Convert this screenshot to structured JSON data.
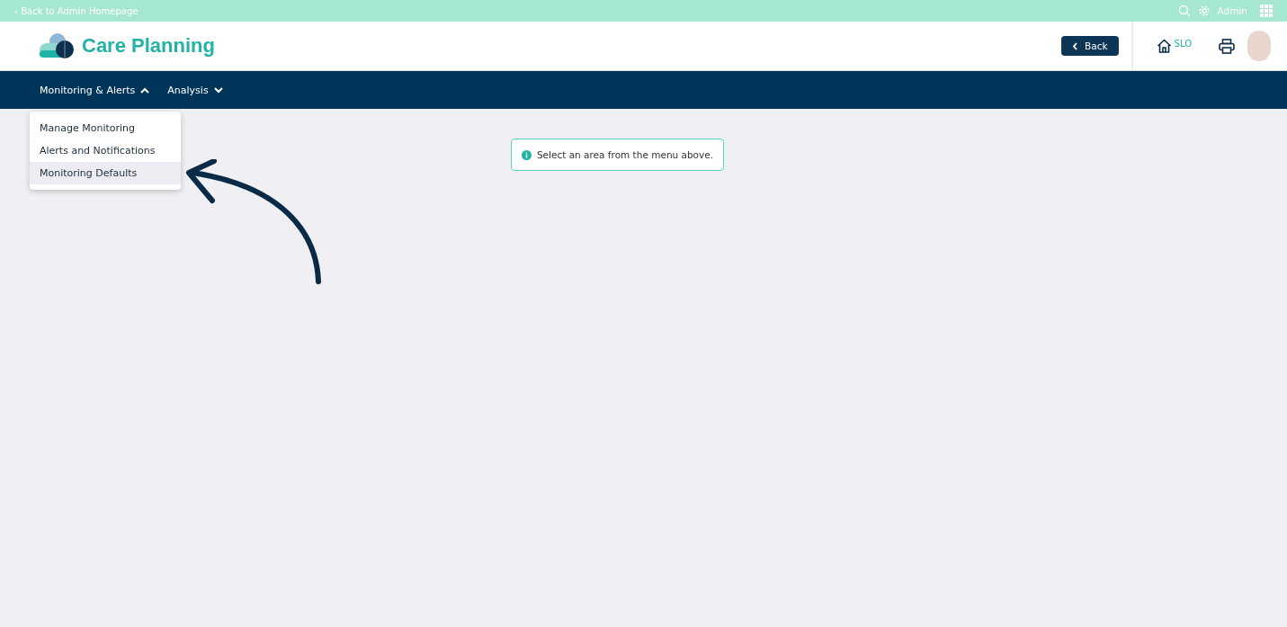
{
  "top_bar": {
    "back_link": "‹ Back to Admin Homepage",
    "user": "Admin"
  },
  "header": {
    "title": "Care Planning",
    "back_button": "Back",
    "home_label": "SLO"
  },
  "nav": [
    {
      "label": "Monitoring & Alerts",
      "expanded": true,
      "menu": [
        {
          "label": "Manage Monitoring",
          "highlighted": false
        },
        {
          "label": "Alerts and Notifications",
          "highlighted": false
        },
        {
          "label": "Monitoring Defaults",
          "highlighted": true
        }
      ]
    },
    {
      "label": "Analysis",
      "expanded": false
    }
  ],
  "notice": "Select an area from the menu above."
}
